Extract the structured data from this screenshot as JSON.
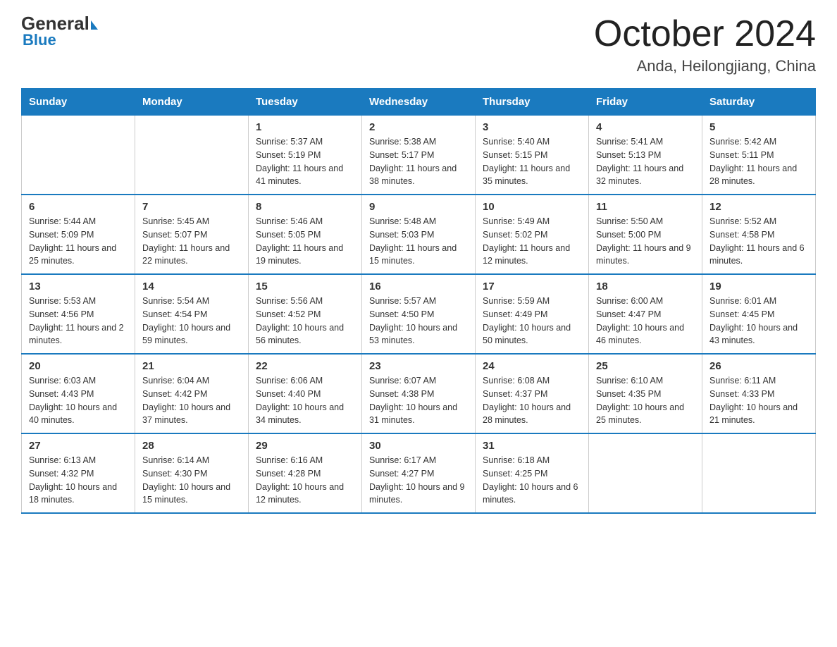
{
  "header": {
    "logo_general": "General",
    "logo_blue": "Blue",
    "month_title": "October 2024",
    "location": "Anda, Heilongjiang, China"
  },
  "weekdays": [
    "Sunday",
    "Monday",
    "Tuesday",
    "Wednesday",
    "Thursday",
    "Friday",
    "Saturday"
  ],
  "weeks": [
    [
      {
        "day": "",
        "sunrise": "",
        "sunset": "",
        "daylight": ""
      },
      {
        "day": "",
        "sunrise": "",
        "sunset": "",
        "daylight": ""
      },
      {
        "day": "1",
        "sunrise": "Sunrise: 5:37 AM",
        "sunset": "Sunset: 5:19 PM",
        "daylight": "Daylight: 11 hours and 41 minutes."
      },
      {
        "day": "2",
        "sunrise": "Sunrise: 5:38 AM",
        "sunset": "Sunset: 5:17 PM",
        "daylight": "Daylight: 11 hours and 38 minutes."
      },
      {
        "day": "3",
        "sunrise": "Sunrise: 5:40 AM",
        "sunset": "Sunset: 5:15 PM",
        "daylight": "Daylight: 11 hours and 35 minutes."
      },
      {
        "day": "4",
        "sunrise": "Sunrise: 5:41 AM",
        "sunset": "Sunset: 5:13 PM",
        "daylight": "Daylight: 11 hours and 32 minutes."
      },
      {
        "day": "5",
        "sunrise": "Sunrise: 5:42 AM",
        "sunset": "Sunset: 5:11 PM",
        "daylight": "Daylight: 11 hours and 28 minutes."
      }
    ],
    [
      {
        "day": "6",
        "sunrise": "Sunrise: 5:44 AM",
        "sunset": "Sunset: 5:09 PM",
        "daylight": "Daylight: 11 hours and 25 minutes."
      },
      {
        "day": "7",
        "sunrise": "Sunrise: 5:45 AM",
        "sunset": "Sunset: 5:07 PM",
        "daylight": "Daylight: 11 hours and 22 minutes."
      },
      {
        "day": "8",
        "sunrise": "Sunrise: 5:46 AM",
        "sunset": "Sunset: 5:05 PM",
        "daylight": "Daylight: 11 hours and 19 minutes."
      },
      {
        "day": "9",
        "sunrise": "Sunrise: 5:48 AM",
        "sunset": "Sunset: 5:03 PM",
        "daylight": "Daylight: 11 hours and 15 minutes."
      },
      {
        "day": "10",
        "sunrise": "Sunrise: 5:49 AM",
        "sunset": "Sunset: 5:02 PM",
        "daylight": "Daylight: 11 hours and 12 minutes."
      },
      {
        "day": "11",
        "sunrise": "Sunrise: 5:50 AM",
        "sunset": "Sunset: 5:00 PM",
        "daylight": "Daylight: 11 hours and 9 minutes."
      },
      {
        "day": "12",
        "sunrise": "Sunrise: 5:52 AM",
        "sunset": "Sunset: 4:58 PM",
        "daylight": "Daylight: 11 hours and 6 minutes."
      }
    ],
    [
      {
        "day": "13",
        "sunrise": "Sunrise: 5:53 AM",
        "sunset": "Sunset: 4:56 PM",
        "daylight": "Daylight: 11 hours and 2 minutes."
      },
      {
        "day": "14",
        "sunrise": "Sunrise: 5:54 AM",
        "sunset": "Sunset: 4:54 PM",
        "daylight": "Daylight: 10 hours and 59 minutes."
      },
      {
        "day": "15",
        "sunrise": "Sunrise: 5:56 AM",
        "sunset": "Sunset: 4:52 PM",
        "daylight": "Daylight: 10 hours and 56 minutes."
      },
      {
        "day": "16",
        "sunrise": "Sunrise: 5:57 AM",
        "sunset": "Sunset: 4:50 PM",
        "daylight": "Daylight: 10 hours and 53 minutes."
      },
      {
        "day": "17",
        "sunrise": "Sunrise: 5:59 AM",
        "sunset": "Sunset: 4:49 PM",
        "daylight": "Daylight: 10 hours and 50 minutes."
      },
      {
        "day": "18",
        "sunrise": "Sunrise: 6:00 AM",
        "sunset": "Sunset: 4:47 PM",
        "daylight": "Daylight: 10 hours and 46 minutes."
      },
      {
        "day": "19",
        "sunrise": "Sunrise: 6:01 AM",
        "sunset": "Sunset: 4:45 PM",
        "daylight": "Daylight: 10 hours and 43 minutes."
      }
    ],
    [
      {
        "day": "20",
        "sunrise": "Sunrise: 6:03 AM",
        "sunset": "Sunset: 4:43 PM",
        "daylight": "Daylight: 10 hours and 40 minutes."
      },
      {
        "day": "21",
        "sunrise": "Sunrise: 6:04 AM",
        "sunset": "Sunset: 4:42 PM",
        "daylight": "Daylight: 10 hours and 37 minutes."
      },
      {
        "day": "22",
        "sunrise": "Sunrise: 6:06 AM",
        "sunset": "Sunset: 4:40 PM",
        "daylight": "Daylight: 10 hours and 34 minutes."
      },
      {
        "day": "23",
        "sunrise": "Sunrise: 6:07 AM",
        "sunset": "Sunset: 4:38 PM",
        "daylight": "Daylight: 10 hours and 31 minutes."
      },
      {
        "day": "24",
        "sunrise": "Sunrise: 6:08 AM",
        "sunset": "Sunset: 4:37 PM",
        "daylight": "Daylight: 10 hours and 28 minutes."
      },
      {
        "day": "25",
        "sunrise": "Sunrise: 6:10 AM",
        "sunset": "Sunset: 4:35 PM",
        "daylight": "Daylight: 10 hours and 25 minutes."
      },
      {
        "day": "26",
        "sunrise": "Sunrise: 6:11 AM",
        "sunset": "Sunset: 4:33 PM",
        "daylight": "Daylight: 10 hours and 21 minutes."
      }
    ],
    [
      {
        "day": "27",
        "sunrise": "Sunrise: 6:13 AM",
        "sunset": "Sunset: 4:32 PM",
        "daylight": "Daylight: 10 hours and 18 minutes."
      },
      {
        "day": "28",
        "sunrise": "Sunrise: 6:14 AM",
        "sunset": "Sunset: 4:30 PM",
        "daylight": "Daylight: 10 hours and 15 minutes."
      },
      {
        "day": "29",
        "sunrise": "Sunrise: 6:16 AM",
        "sunset": "Sunset: 4:28 PM",
        "daylight": "Daylight: 10 hours and 12 minutes."
      },
      {
        "day": "30",
        "sunrise": "Sunrise: 6:17 AM",
        "sunset": "Sunset: 4:27 PM",
        "daylight": "Daylight: 10 hours and 9 minutes."
      },
      {
        "day": "31",
        "sunrise": "Sunrise: 6:18 AM",
        "sunset": "Sunset: 4:25 PM",
        "daylight": "Daylight: 10 hours and 6 minutes."
      },
      {
        "day": "",
        "sunrise": "",
        "sunset": "",
        "daylight": ""
      },
      {
        "day": "",
        "sunrise": "",
        "sunset": "",
        "daylight": ""
      }
    ]
  ]
}
